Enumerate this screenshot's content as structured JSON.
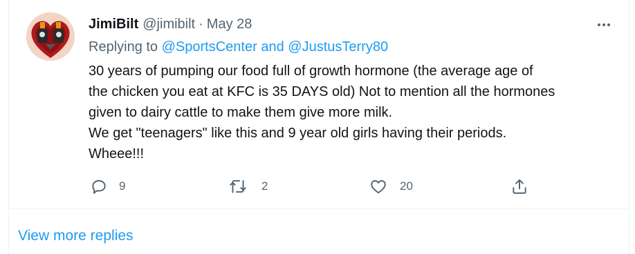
{
  "tweet": {
    "name": "JimiBilt",
    "handle": "@jimibilt",
    "separator": "·",
    "date": "May 28",
    "replying_prefix": "Replying to",
    "mention_1": "@SportsCenter",
    "replying_and": "and",
    "mention_2": "@JustusTerry80",
    "body_lines": [
      "30 years of pumping our food full of growth hormone (the average age of",
      "the chicken you eat at KFC is 35 DAYS old) Not to mention all the hormones",
      "given to dairy cattle to make them give more milk.",
      "We get \"teenagers\" like this and 9 year old girls having their periods.",
      "Wheee!!!"
    ],
    "reply_count": "9",
    "retweet_count": "2",
    "like_count": "20"
  },
  "view_more": "View more replies",
  "icons": {
    "more": "more-horizontal-icon",
    "reply": "reply-bubble-icon",
    "retweet": "retweet-icon",
    "like": "heart-icon",
    "share": "share-icon"
  },
  "colors": {
    "link": "#1d9bf0",
    "secondary_text": "#536471",
    "primary_text": "#0f1419",
    "divider": "#eff3f4"
  }
}
